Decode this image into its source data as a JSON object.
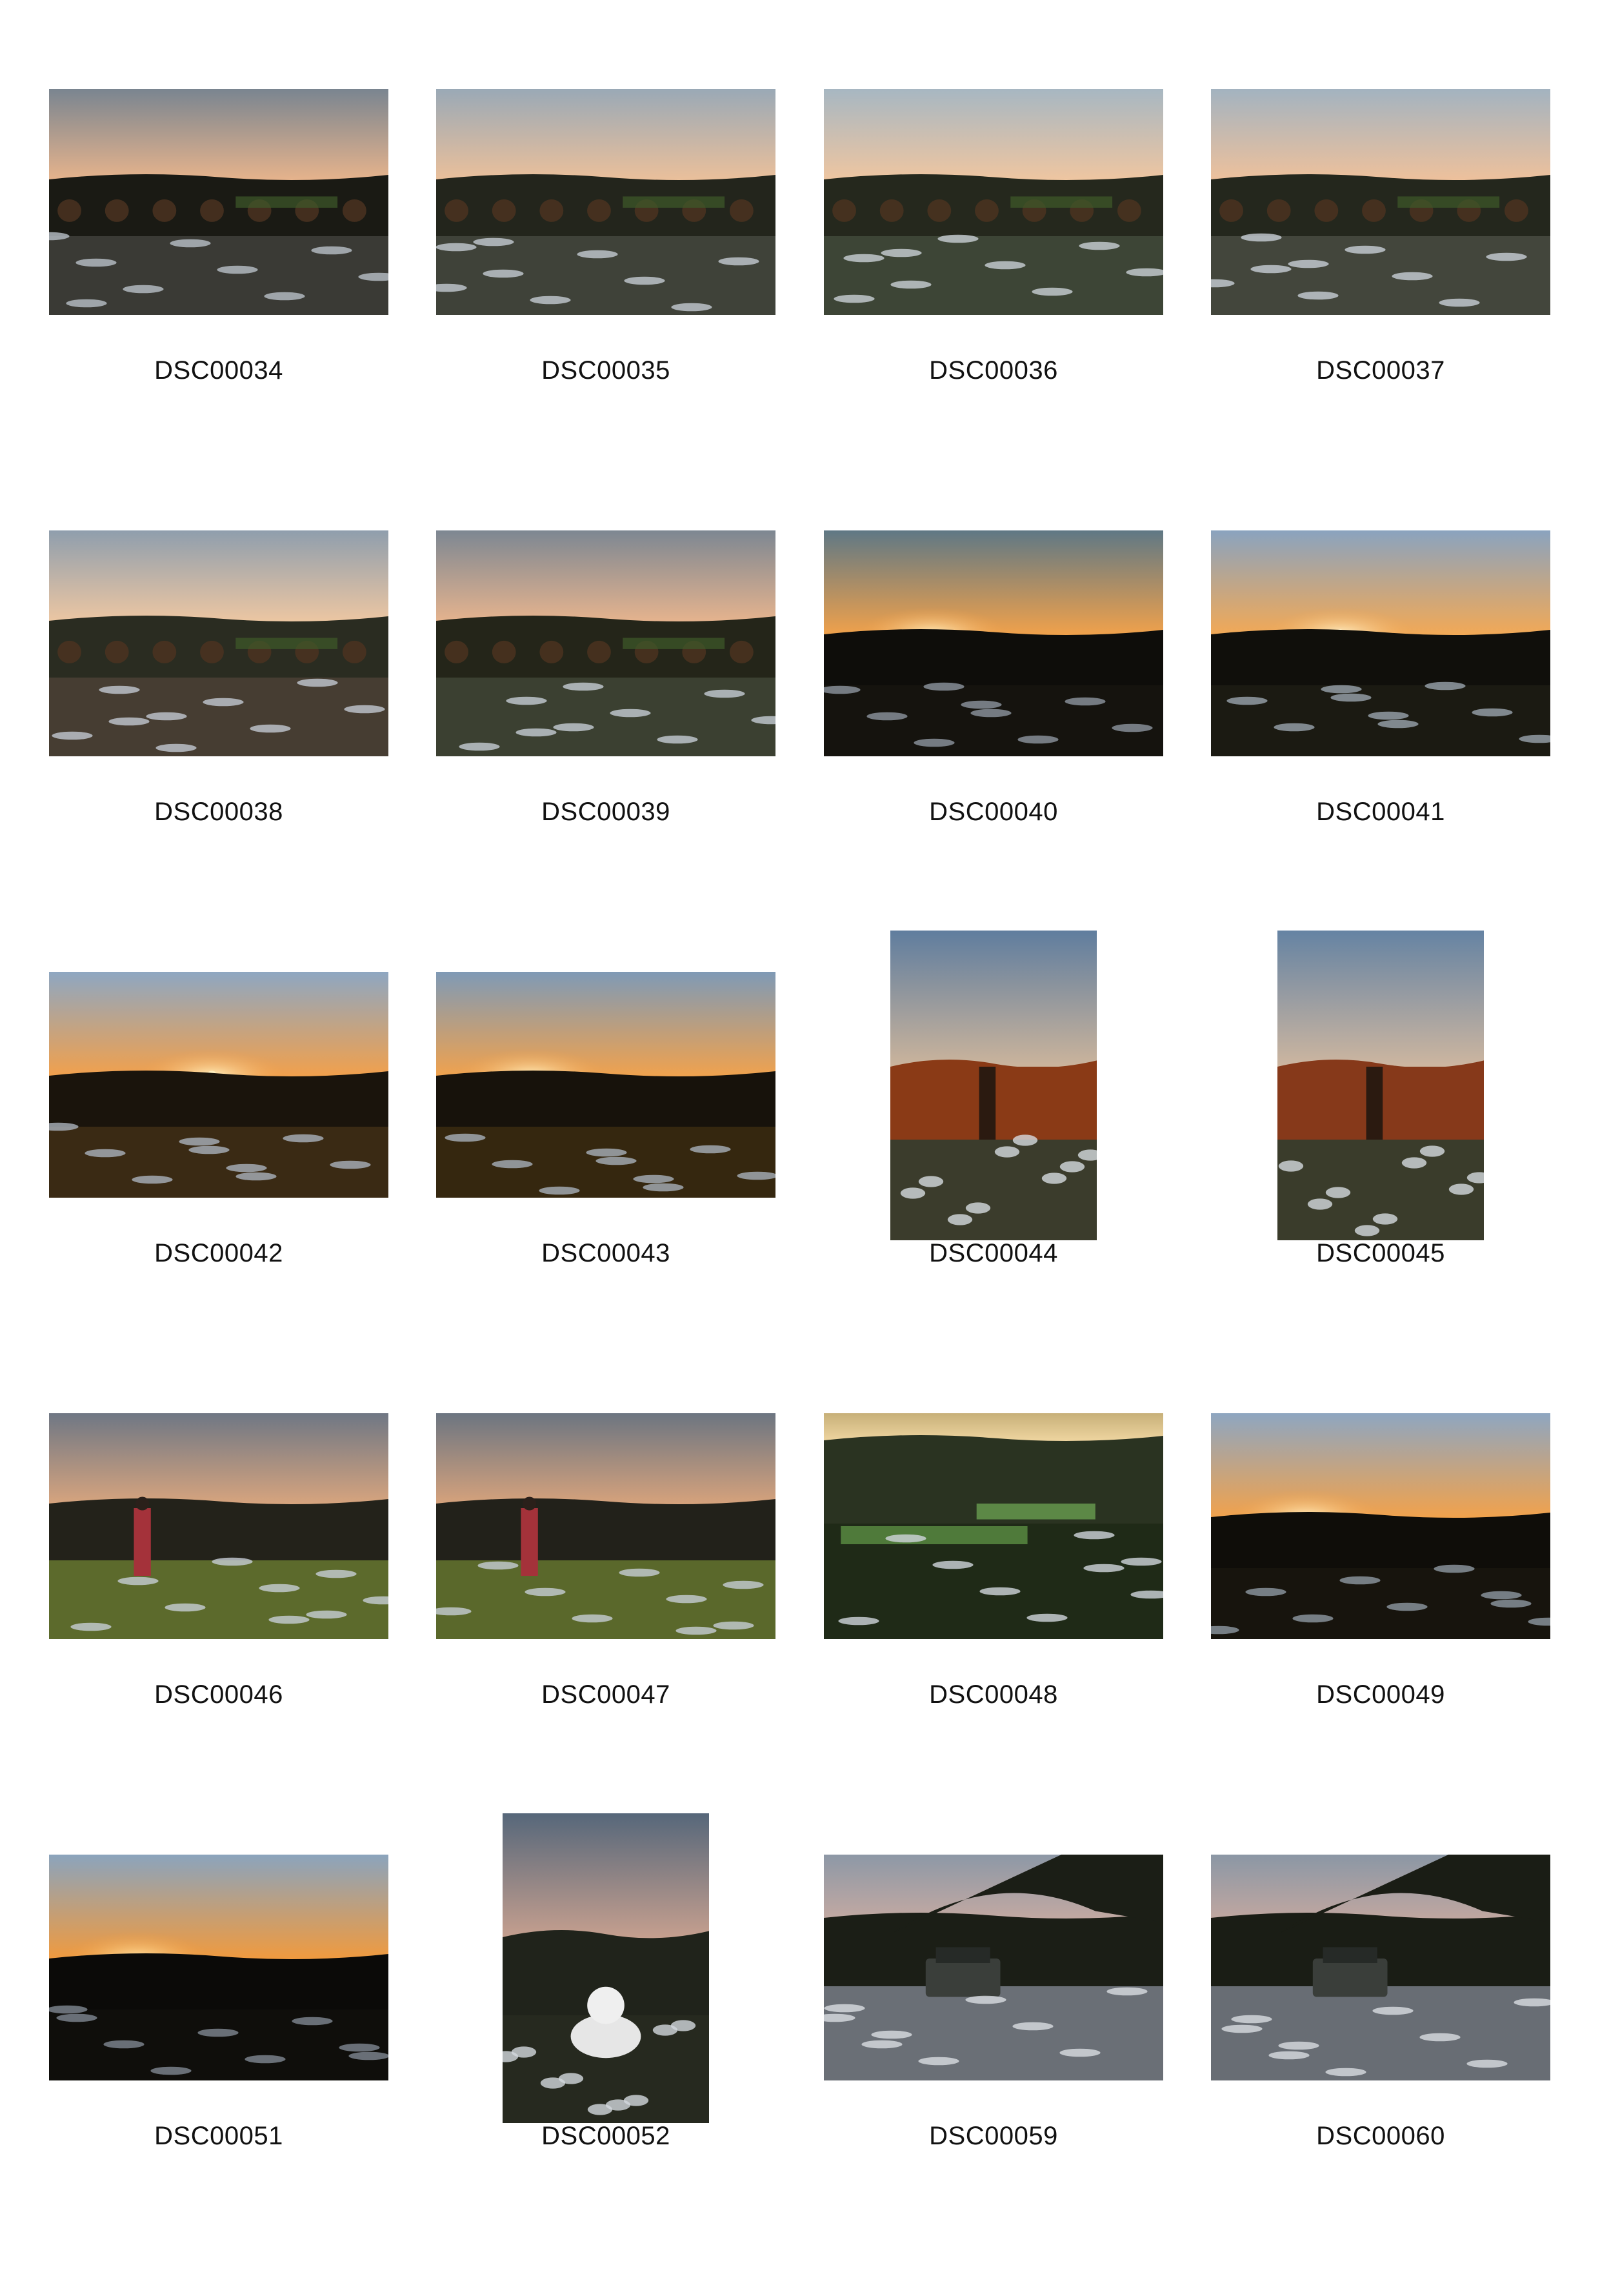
{
  "contact_sheet": {
    "frames": [
      {
        "label": "DSC00034",
        "orientation": "landscape",
        "scene": "hills",
        "colors": {
          "sky_top": "#7a8590",
          "sky_bottom": "#e8b48c",
          "land": "#1a1a14",
          "ground": "#3a3a35",
          "snow": "#b9c0c8",
          "sun": ""
        }
      },
      {
        "label": "DSC00035",
        "orientation": "landscape",
        "scene": "hills",
        "colors": {
          "sky_top": "#9aa9b6",
          "sky_bottom": "#ecc09a",
          "land": "#23251c",
          "ground": "#3f4239",
          "snow": "#c4cad2",
          "sun": ""
        }
      },
      {
        "label": "DSC00036",
        "orientation": "landscape",
        "scene": "path",
        "colors": {
          "sky_top": "#a7b7c2",
          "sky_bottom": "#f0c6a0",
          "land": "#25281d",
          "ground": "#3d4536",
          "snow": "#c9cfd6",
          "sun": ""
        }
      },
      {
        "label": "DSC00037",
        "orientation": "landscape",
        "scene": "hills",
        "colors": {
          "sky_top": "#a3b3c0",
          "sky_bottom": "#efc19b",
          "land": "#24271d",
          "ground": "#43463c",
          "snow": "#c8ced6",
          "sun": ""
        }
      },
      {
        "label": "DSC00038",
        "orientation": "landscape",
        "scene": "hills",
        "colors": {
          "sky_top": "#8f9ead",
          "sky_bottom": "#eec7a2",
          "land": "#2a2c21",
          "ground": "#463d32",
          "snow": "#c2c8d1",
          "sun": ""
        }
      },
      {
        "label": "DSC00039",
        "orientation": "landscape",
        "scene": "path",
        "colors": {
          "sky_top": "#7d8792",
          "sky_bottom": "#e7b48e",
          "land": "#242519",
          "ground": "#3b4031",
          "snow": "#c6ccd4",
          "sun": ""
        }
      },
      {
        "label": "DSC00040",
        "orientation": "landscape",
        "scene": "sunset",
        "colors": {
          "sky_top": "#5f7885",
          "sky_bottom": "#f3a24a",
          "land": "#0e0d0a",
          "ground": "#15130e",
          "snow": "#8d96a0",
          "sun": "#fff1c4"
        }
      },
      {
        "label": "DSC00041",
        "orientation": "landscape",
        "scene": "sunset",
        "colors": {
          "sky_top": "#8aa3bf",
          "sky_bottom": "#f4a954",
          "land": "#100f0b",
          "ground": "#1b1a12",
          "snow": "#9aa4ae",
          "sun": "#fff3cc"
        }
      },
      {
        "label": "DSC00042",
        "orientation": "landscape",
        "scene": "sunset",
        "colors": {
          "sky_top": "#8ea7c2",
          "sky_bottom": "#f3a04a",
          "land": "#1a140c",
          "ground": "#3a2a14",
          "snow": "#aab2bb",
          "sun": "#fff0c0"
        }
      },
      {
        "label": "DSC00043",
        "orientation": "landscape",
        "scene": "sunset",
        "colors": {
          "sky_top": "#7f9ab6",
          "sky_bottom": "#f2a24c",
          "land": "#17120b",
          "ground": "#35270f",
          "snow": "#a8b0b9",
          "sun": "#fff1c2"
        }
      },
      {
        "label": "DSC00044",
        "orientation": "portrait",
        "scene": "hedge",
        "colors": {
          "sky_top": "#5f7d9e",
          "sky_bottom": "#cdb59c",
          "land": "#8a3a16",
          "ground": "#3b3c2c",
          "snow": "#d6dbe0",
          "sun": ""
        }
      },
      {
        "label": "DSC00045",
        "orientation": "portrait",
        "scene": "hedge",
        "colors": {
          "sky_top": "#6583a3",
          "sky_bottom": "#cfb7a0",
          "land": "#86391a",
          "ground": "#3a3c2b",
          "snow": "#d4d9df",
          "sun": ""
        }
      },
      {
        "label": "DSC00046",
        "orientation": "landscape",
        "scene": "person",
        "colors": {
          "sky_top": "#6f7784",
          "sky_bottom": "#d9a57e",
          "land": "#23221a",
          "ground": "#5c6a2c",
          "snow": "#c7ced6",
          "sun": ""
        }
      },
      {
        "label": "DSC00047",
        "orientation": "landscape",
        "scene": "person",
        "colors": {
          "sky_top": "#6c7581",
          "sky_bottom": "#d8a37c",
          "land": "#22211a",
          "ground": "#5a682b",
          "snow": "#c6cdd5",
          "sun": ""
        }
      },
      {
        "label": "DSC00048",
        "orientation": "landscape",
        "scene": "valley",
        "colors": {
          "sky_top": "#c7b079",
          "sky_bottom": "#f1d7a2",
          "land": "#2a3321",
          "ground": "#1f2a17",
          "snow": "#d0d6dc",
          "sun": ""
        }
      },
      {
        "label": "DSC00049",
        "orientation": "landscape",
        "scene": "sunset",
        "colors": {
          "sky_top": "#8ea6c1",
          "sky_bottom": "#f3a24a",
          "land": "#0f0d09",
          "ground": "#17140d",
          "snow": "#8f98a2",
          "sun": "#fff1c4"
        }
      },
      {
        "label": "DSC00051",
        "orientation": "landscape",
        "scene": "sunset",
        "colors": {
          "sky_top": "#8ba4bd",
          "sky_bottom": "#f29a3c",
          "land": "#0b0a08",
          "ground": "#0f0e0b",
          "snow": "#7f8892",
          "sun": "#ffe6a8"
        }
      },
      {
        "label": "DSC00052",
        "orientation": "portrait",
        "scene": "snowman",
        "colors": {
          "sky_top": "#56677a",
          "sky_bottom": "#c7a08f",
          "land": "#20231b",
          "ground": "#26291f",
          "snow": "#d3d8dd",
          "sun": ""
        }
      },
      {
        "label": "DSC00059",
        "orientation": "landscape",
        "scene": "car",
        "colors": {
          "sky_top": "#8d98a6",
          "sky_bottom": "#c3a9a2",
          "land": "#1b1e16",
          "ground": "#6a6f76",
          "snow": "#d9dde2",
          "sun": ""
        }
      },
      {
        "label": "DSC00060",
        "orientation": "landscape",
        "scene": "car",
        "colors": {
          "sky_top": "#8b97a5",
          "sky_bottom": "#c1a7a0",
          "land": "#1a1d15",
          "ground": "#686d74",
          "snow": "#d8dce1",
          "sun": ""
        }
      }
    ]
  }
}
